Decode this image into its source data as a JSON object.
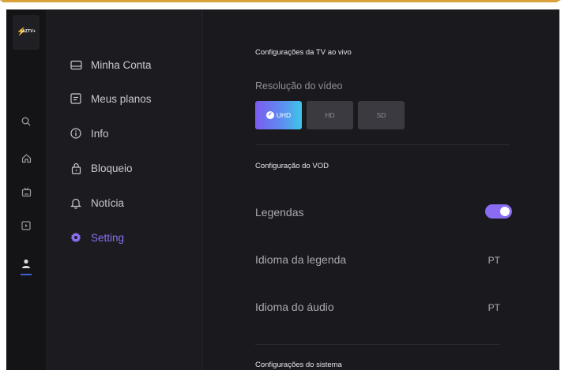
{
  "brand": {
    "logo_text": "AZTV+"
  },
  "rail": {
    "icons": [
      "search-icon",
      "home-icon",
      "tv-icon",
      "play-icon",
      "user-icon"
    ],
    "active": "user-icon"
  },
  "menu": {
    "items": [
      {
        "label": "Minha Conta",
        "icon": "account-card-icon"
      },
      {
        "label": "Meus planos",
        "icon": "plans-icon"
      },
      {
        "label": "Info",
        "icon": "info-icon"
      },
      {
        "label": "Bloqueio",
        "icon": "lock-icon"
      },
      {
        "label": "Notícia",
        "icon": "bell-icon"
      },
      {
        "label": "Setting",
        "icon": "gear-icon"
      }
    ],
    "active": "Setting"
  },
  "live_tv": {
    "title": "Configurações da TV ao vivo",
    "resolution_label": "Resolução do vídeo",
    "resolutions": [
      "UHD",
      "HD",
      "SD"
    ],
    "selected": "UHD"
  },
  "vod": {
    "title": "Configuração do VOD",
    "subtitles_label": "Legendas",
    "subtitles_enabled": true,
    "subtitle_language_label": "Idioma da legenda",
    "subtitle_language_value": "PT",
    "audio_language_label": "Idioma do áudio",
    "audio_language_value": "PT"
  },
  "system": {
    "title": "Configurações do sistema"
  },
  "colors": {
    "accent": "#8b6ff2",
    "frame_border": "#d9a33a",
    "background": "#17171b"
  }
}
